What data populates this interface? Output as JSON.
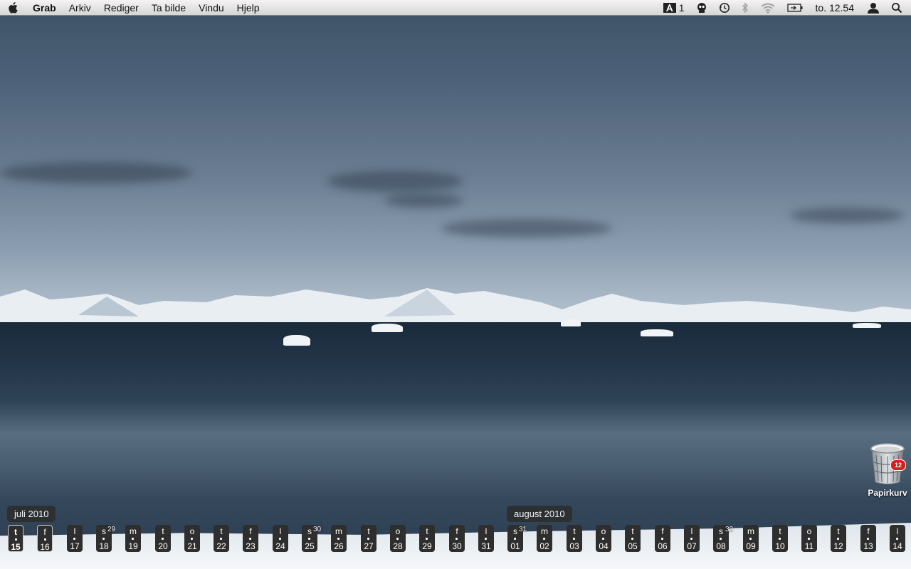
{
  "menubar": {
    "apple_icon": "apple-icon",
    "app_name": "Grab",
    "menus": [
      "Arkiv",
      "Rediger",
      "Ta bilde",
      "Vindu",
      "Hjelp"
    ],
    "status": {
      "adobe_count": "1",
      "clock": "to. 12.54"
    }
  },
  "desktop": {
    "trash_label": "Papirkurv",
    "trash_badge": "12"
  },
  "calendar": {
    "months": [
      {
        "label": "juli 2010"
      },
      {
        "label": "august 2010"
      }
    ],
    "days": [
      {
        "l": "t",
        "n": "15"
      },
      {
        "l": "f",
        "n": "16"
      },
      {
        "l": "l",
        "n": "17"
      },
      {
        "l": "s",
        "n": "18"
      },
      {
        "l": "m",
        "n": "19"
      },
      {
        "l": "t",
        "n": "20"
      },
      {
        "l": "o",
        "n": "21"
      },
      {
        "l": "t",
        "n": "22"
      },
      {
        "l": "f",
        "n": "23"
      },
      {
        "l": "l",
        "n": "24"
      },
      {
        "l": "s",
        "n": "25"
      },
      {
        "l": "m",
        "n": "26"
      },
      {
        "l": "t",
        "n": "27"
      },
      {
        "l": "o",
        "n": "28"
      },
      {
        "l": "t",
        "n": "29"
      },
      {
        "l": "f",
        "n": "30"
      },
      {
        "l": "l",
        "n": "31"
      },
      {
        "l": "s",
        "n": "01"
      },
      {
        "l": "m",
        "n": "02"
      },
      {
        "l": "t",
        "n": "03"
      },
      {
        "l": "o",
        "n": "04"
      },
      {
        "l": "t",
        "n": "05"
      },
      {
        "l": "f",
        "n": "06"
      },
      {
        "l": "l",
        "n": "07"
      },
      {
        "l": "s",
        "n": "08"
      },
      {
        "l": "m",
        "n": "09"
      },
      {
        "l": "t",
        "n": "10"
      },
      {
        "l": "o",
        "n": "11"
      },
      {
        "l": "t",
        "n": "12"
      },
      {
        "l": "f",
        "n": "13"
      },
      {
        "l": "l",
        "n": "14"
      }
    ],
    "week_numbers": [
      "29",
      "30",
      "31",
      "32"
    ],
    "today": "15"
  },
  "colors": {
    "menubar": "#e4e4e4",
    "day_tile": "#2e2e2e",
    "badge": "#d81d1d"
  }
}
